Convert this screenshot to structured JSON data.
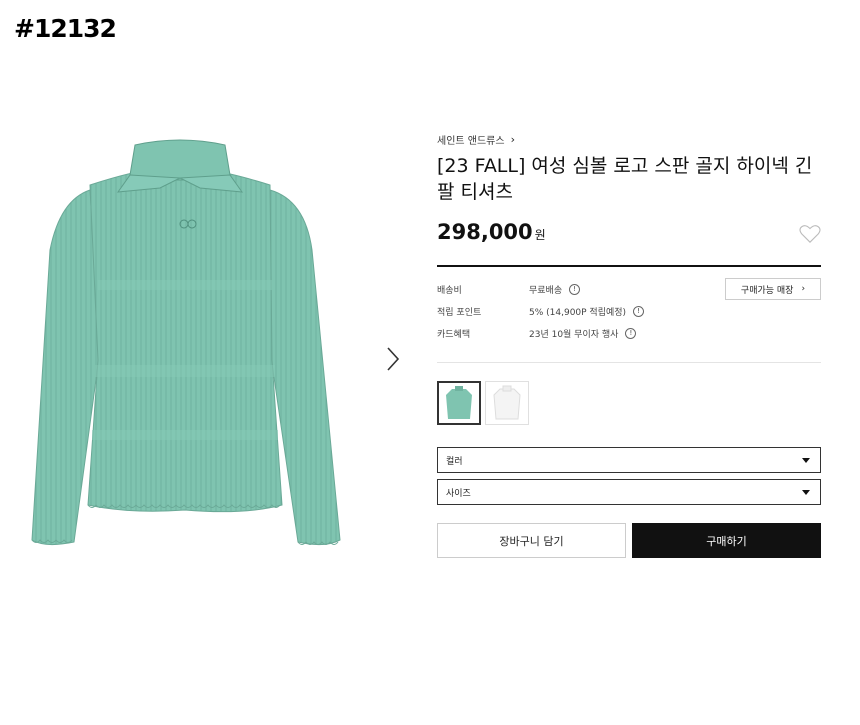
{
  "watermark": "#12132",
  "product": {
    "brand": "세인트 앤드류스",
    "title": "[23 FALL] 여성 심볼 로고 스판 골지 하이넥 긴팔 티셔츠",
    "price": "298,000",
    "currency": "원"
  },
  "details": [
    {
      "label": "배송비",
      "value": "무료배송"
    },
    {
      "label": "적립 포인트",
      "value": "5% (14,900P 적립예정)"
    },
    {
      "label": "카드혜택",
      "value": "23년 10월 무이자 행사"
    }
  ],
  "store_button": "구매가능 매장",
  "colors": {
    "swatch_selected": "#7fc4b0",
    "swatch_other": "#f4f4f4",
    "accent_dark": "#111111"
  },
  "options": {
    "color": "컬러",
    "size": "사이즈"
  },
  "actions": {
    "cart": "장바구니 담기",
    "buy": "구매하기"
  }
}
